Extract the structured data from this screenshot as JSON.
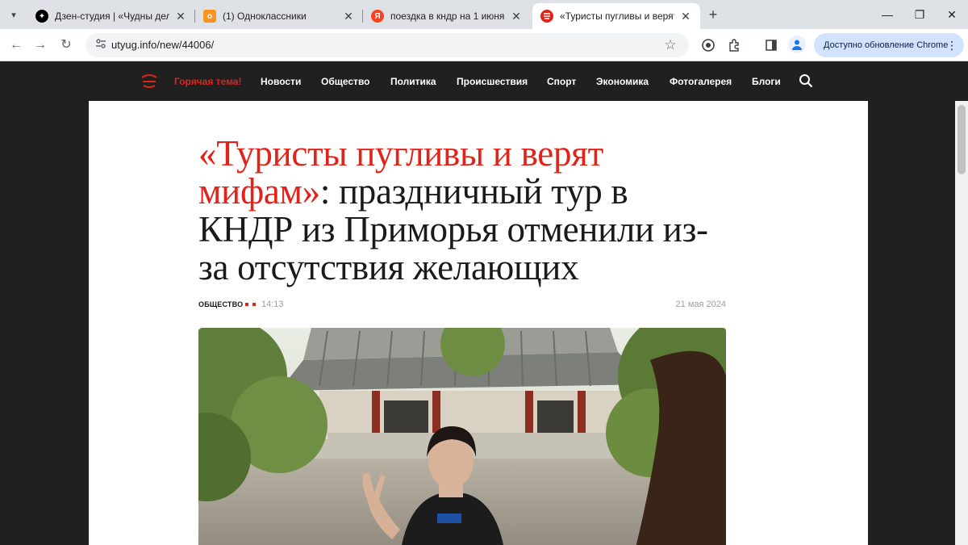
{
  "browser": {
    "tabs": [
      {
        "title": "Дзен-студия | «Чудны дела тво",
        "favicon": "zen-icon",
        "color": "#000000"
      },
      {
        "title": "(1) Одноклассники",
        "favicon": "ok-icon",
        "color": "#f7931e"
      },
      {
        "title": "поездка в кндр на 1 июня отм",
        "favicon": "yandex-icon",
        "color": "#fc3f1d"
      },
      {
        "title": "«Туристы пугливы и верят ми",
        "favicon": "utyug-icon",
        "color": "#e2231a"
      }
    ],
    "url": "utyug.info/new/44006/",
    "update_label": "Доступно обновление Chrome"
  },
  "site": {
    "nav": {
      "hot": "Горячая тема!",
      "items": [
        "Новости",
        "Общество",
        "Политика",
        "Происшествия",
        "Спорт",
        "Экономика",
        "Фотогалерея",
        "Блоги"
      ]
    },
    "accent_color": "#e2231a"
  },
  "article": {
    "headline_accent": "«Туристы пугливы и верят мифам»",
    "headline_rest": ": праздничный тур в КНДР из Приморья отменили из-за отсутствия желающих",
    "rubric": "ОБЩЕСТВО",
    "time": "14:13",
    "date": "21 мая 2024"
  }
}
